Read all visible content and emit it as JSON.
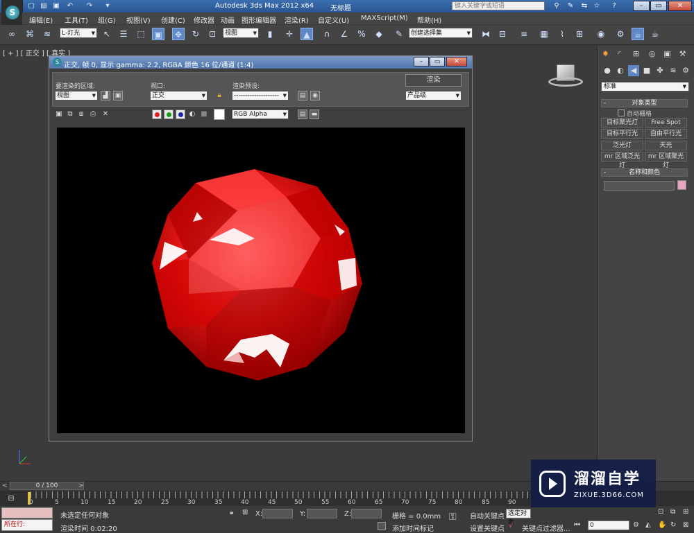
{
  "app": {
    "title": "Autodesk 3ds Max  2012 x64",
    "document": "无标题",
    "search_placeholder": "键入关键字或短语"
  },
  "menu": [
    "编辑(E)",
    "工具(T)",
    "组(G)",
    "视图(V)",
    "创建(C)",
    "修改器",
    "动画",
    "图形编辑器",
    "渲染(R)",
    "自定义(U)",
    "MAXScript(M)",
    "帮助(H)"
  ],
  "toolbar": {
    "selection_filter": "L-灯光",
    "ref_coord": "视图",
    "named_selection": "创建选择集"
  },
  "viewport": {
    "label": "[ + ] [ 正交 ] [ 真实 ]"
  },
  "render_window": {
    "title": "正交, 帧 0, 显示 gamma: 2.2, RGBA 颜色 16 位/通道 (1:4)",
    "area_label": "要渲染的区域:",
    "area_value": "视图",
    "viewport_label": "视口:",
    "viewport_value": "正交",
    "preset_label": "渲染预设:",
    "preset_value": "--------------------",
    "render_button": "渲染",
    "quality_value": "产品级",
    "channel_value": "RGB Alpha",
    "channel_colors": {
      "red": "#e02020",
      "green": "#1a9a1a",
      "blue": "#1a2ab0"
    }
  },
  "command_panel": {
    "category": "标准",
    "object_type_header": "对象类型",
    "auto_grid": "自动栅格",
    "light_buttons": [
      "目标聚光灯",
      "Free Spot",
      "目标平行光",
      "自由平行光",
      "泛光灯",
      "天光",
      "mr 区域泛光灯",
      "mr 区域聚光灯"
    ],
    "name_color_header": "名称和颜色",
    "object_color": "#e8a4c0"
  },
  "timeline": {
    "slider": "0 / 100",
    "ticks": [
      "0",
      "5",
      "10",
      "15",
      "20",
      "25",
      "30",
      "35",
      "40",
      "45",
      "50",
      "55",
      "60",
      "65",
      "70",
      "75",
      "80",
      "85",
      "90"
    ]
  },
  "status": {
    "running": "所在行:",
    "selection": "未选定任何对象",
    "render_time": "渲染时间  0:02:20",
    "x_label": "X:",
    "y_label": "Y:",
    "z_label": "Z:",
    "grid": "栅格 = 0.0mm",
    "add_time_tag": "添加时间标记",
    "auto_key": "自动关键点",
    "set_key": "设置关键点",
    "key_mode": "选定对象",
    "key_filters": "关键点过滤器...",
    "frame": "0"
  },
  "watermark": {
    "main": "溜溜自学",
    "sub": "ZIXUE.3D66.COM"
  }
}
